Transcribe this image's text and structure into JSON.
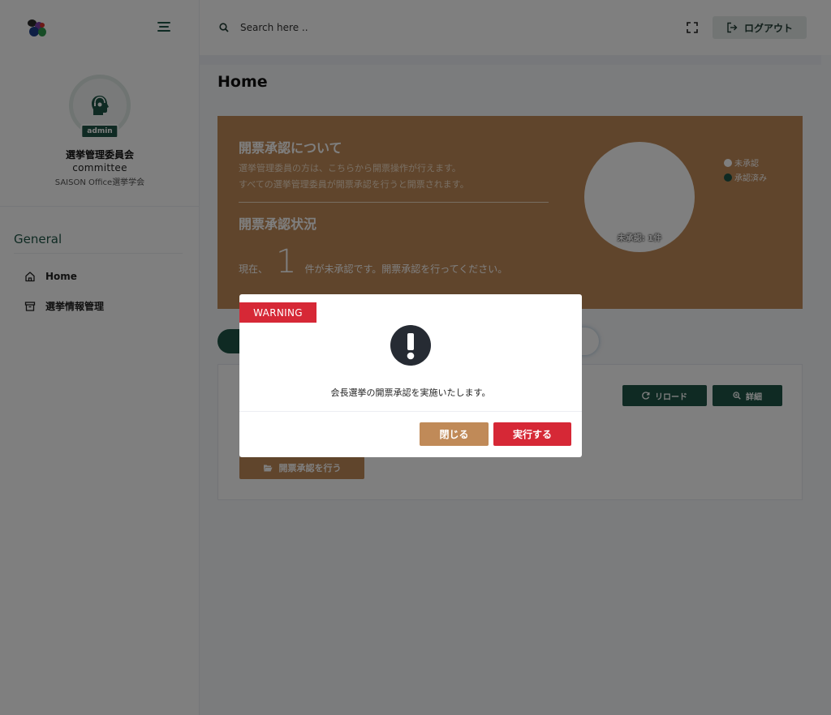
{
  "colors": {
    "brand": "#1f5546",
    "banner": "#c08a58",
    "danger": "#d62836",
    "overlay": "rgba(0,0,0,0.5)"
  },
  "sidebar": {
    "logo_icon": "logo-icon",
    "menu_icon": "hamburger-menu-icon",
    "profile": {
      "avatar_icon": "headset-person-icon",
      "role_badge": "admin",
      "name": "選挙管理委員会",
      "role": "committee",
      "organization": "SAISON Office選挙学会"
    },
    "section_title": "General",
    "items": [
      {
        "label": "Home",
        "icon": "home-icon"
      },
      {
        "label": "選挙情報管理",
        "icon": "archive-icon"
      }
    ]
  },
  "header": {
    "search": {
      "placeholder": "Search here ..",
      "icon": "search-icon"
    },
    "fullscreen_icon": "fullscreen-icon",
    "logout": {
      "label": "ログアウト",
      "icon": "logout-icon"
    }
  },
  "main": {
    "page_title": "Home",
    "banner": {
      "heading": "開票承認について",
      "description_lines": [
        "選挙管理委員の方は、こちらから開票操作が行えます。",
        "すべての選挙管理委員が開票承認を行うと開票されます。"
      ],
      "status_heading": "開票承認状況",
      "status_prefix": "現在、",
      "pending_count": "1",
      "status_suffix": "件が未承認です。開票承認を行ってください。",
      "chart_label": "未承認: 1件",
      "legend": [
        {
          "label": "未承認",
          "color": "#ffffff"
        },
        {
          "label": "承認済み",
          "color": "#1f5546"
        }
      ]
    },
    "card": {
      "reload_label": "リロード",
      "reload_icon": "refresh-icon",
      "detail_label": "詳細",
      "detail_icon": "zoom-icon",
      "approve_label": "開票承認を行う",
      "approve_icon": "folder-open-icon"
    }
  },
  "chart_data": {
    "type": "pie",
    "categories": [
      "未承認",
      "承認済み"
    ],
    "values": [
      1,
      0
    ],
    "slice_label": "未承認: 1件",
    "legend_position": "top-right"
  },
  "modal": {
    "tag": "WARNING",
    "icon": "exclamation-circle-icon",
    "message": "会長選挙の開票承認を実施いたします。",
    "close_label": "閉じる",
    "execute_label": "実行する"
  }
}
